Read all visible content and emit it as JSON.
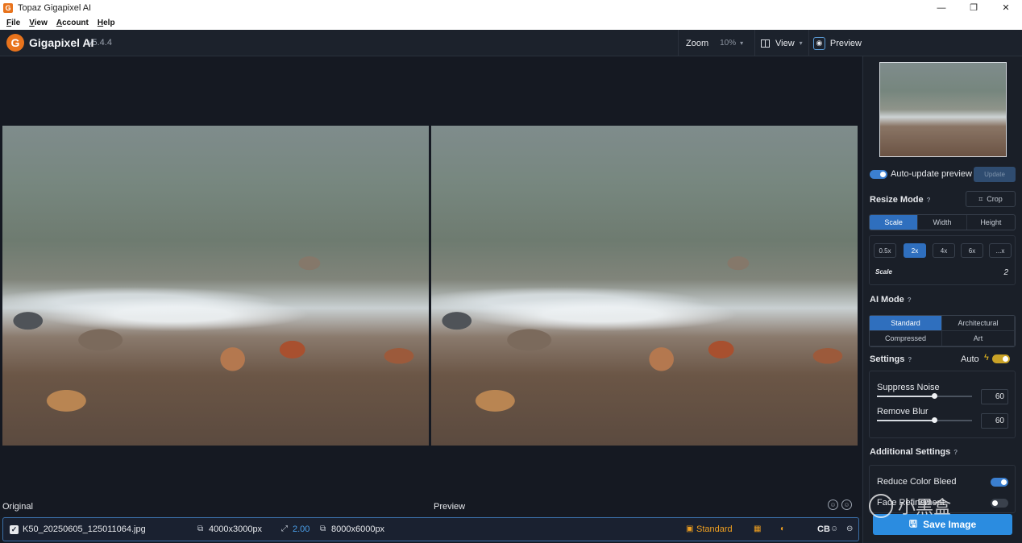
{
  "window": {
    "title": "Topaz Gigapixel AI",
    "icon": "G",
    "controls": [
      "—",
      "❐",
      "✕"
    ]
  },
  "menu": [
    "File",
    "View",
    "Account",
    "Help"
  ],
  "header": {
    "logo_letter": "G",
    "app_name": "Gigapixel AI",
    "version": "v5.4.4",
    "zoom_label": "Zoom",
    "zoom_value": "10%",
    "view_label": "View",
    "preview_label": "Preview"
  },
  "canvas": {
    "original_label": "Original",
    "preview_label": "Preview"
  },
  "filebar": {
    "checked": true,
    "filename": "K50_20250605_125011064.jpg",
    "input_size": "4000x3000px",
    "scale": "2.00",
    "output_size": "8000x6000px",
    "model": "Standard",
    "cb_label": "CB"
  },
  "sidebar": {
    "auto_update_label": "Auto-update preview",
    "auto_update_on": true,
    "update_button": "Update",
    "resize_mode_label": "Resize Mode",
    "crop_button": "Crop",
    "resize_tabs": [
      "Scale",
      "Width",
      "Height"
    ],
    "resize_active": "Scale",
    "scale_chips": [
      "0.5x",
      "2x",
      "4x",
      "6x",
      "...x"
    ],
    "scale_active": "2x",
    "scale_label": "Scale",
    "scale_value": "2",
    "ai_mode_label": "AI Mode",
    "ai_modes": [
      "Standard",
      "Architectural",
      "Compressed",
      "Art"
    ],
    "ai_mode_active": "Standard",
    "settings_label": "Settings",
    "auto_label": "Auto",
    "suppress_noise_label": "Suppress Noise",
    "suppress_noise_value": "60",
    "suppress_noise_level": 0.6,
    "remove_blur_label": "Remove Blur",
    "remove_blur_value": "60",
    "remove_blur_level": 0.6,
    "additional_settings_label": "Additional Settings",
    "reduce_color_bleed_label": "Reduce Color Bleed",
    "reduce_color_bleed_on": true,
    "face_refinement_label": "Face Refinement",
    "face_refinement_on": false,
    "save_button": "Save Image"
  },
  "watermark": "小黑盒",
  "colors": {
    "accent": "#2f6fbe",
    "save": "#2b8ce0",
    "model": "#f0a020",
    "brand": "#e8731c"
  }
}
